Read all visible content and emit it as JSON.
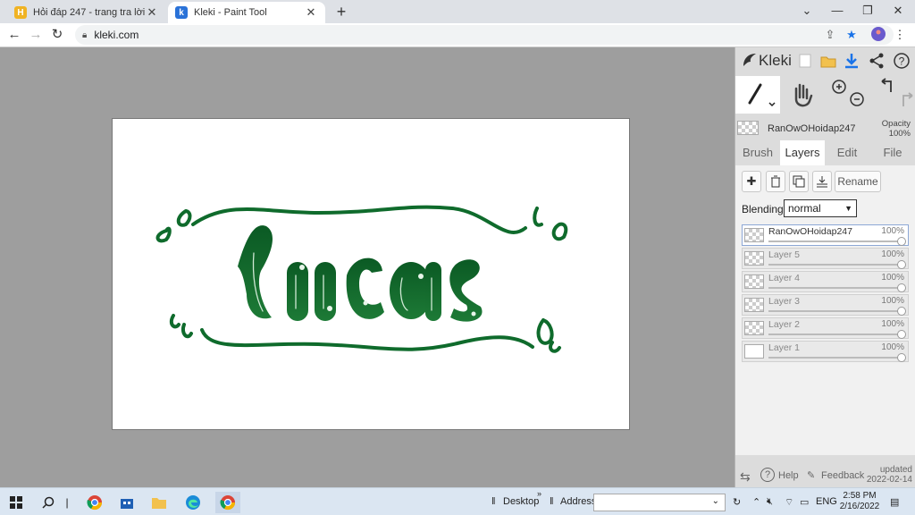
{
  "browser": {
    "tabs": [
      {
        "title": "Hỏi đáp 247 - trang tra lời",
        "active": false
      },
      {
        "title": "Kleki - Paint Tool",
        "active": true
      }
    ],
    "url": "kleki.com",
    "colors": {
      "tab1_favicon": "#f0b323",
      "tab2_favicon": "#2a72d8",
      "profile": "#6a5acd"
    }
  },
  "canvas": {
    "drawing_text": "Lucas",
    "ink_color": "#0f6b2c"
  },
  "kleki": {
    "logo_text": "Kleki",
    "current_layer": {
      "name": "RanOwOHoidap247",
      "opacity_label": "Opacity",
      "opacity_value": "100%"
    },
    "tabs": [
      "Brush",
      "Layers",
      "Edit",
      "File"
    ],
    "active_tab": "Layers",
    "rename_label": "Rename",
    "blending_label": "Blending",
    "blending_value": "normal",
    "layers": [
      {
        "name": "RanOwOHoidap247",
        "opacity": "100%",
        "selected": true
      },
      {
        "name": "Layer 5",
        "opacity": "100%",
        "selected": false
      },
      {
        "name": "Layer 4",
        "opacity": "100%",
        "selected": false
      },
      {
        "name": "Layer 3",
        "opacity": "100%",
        "selected": false
      },
      {
        "name": "Layer 2",
        "opacity": "100%",
        "selected": false
      },
      {
        "name": "Layer 1",
        "opacity": "100%",
        "selected": false
      }
    ],
    "footer": {
      "help": "Help",
      "feedback": "Feedback",
      "updated_label": "updated",
      "updated_date": "2022-02-14"
    }
  },
  "taskbar": {
    "desktop_label": "Desktop",
    "address_label": "Address",
    "language": "ENG",
    "time": "2:58 PM",
    "date": "2/16/2022",
    "icons": [
      "windows-start-icon",
      "search-icon",
      "chrome-icon",
      "store-icon",
      "folder-icon",
      "edge-icon",
      "chrome-active-icon"
    ]
  }
}
